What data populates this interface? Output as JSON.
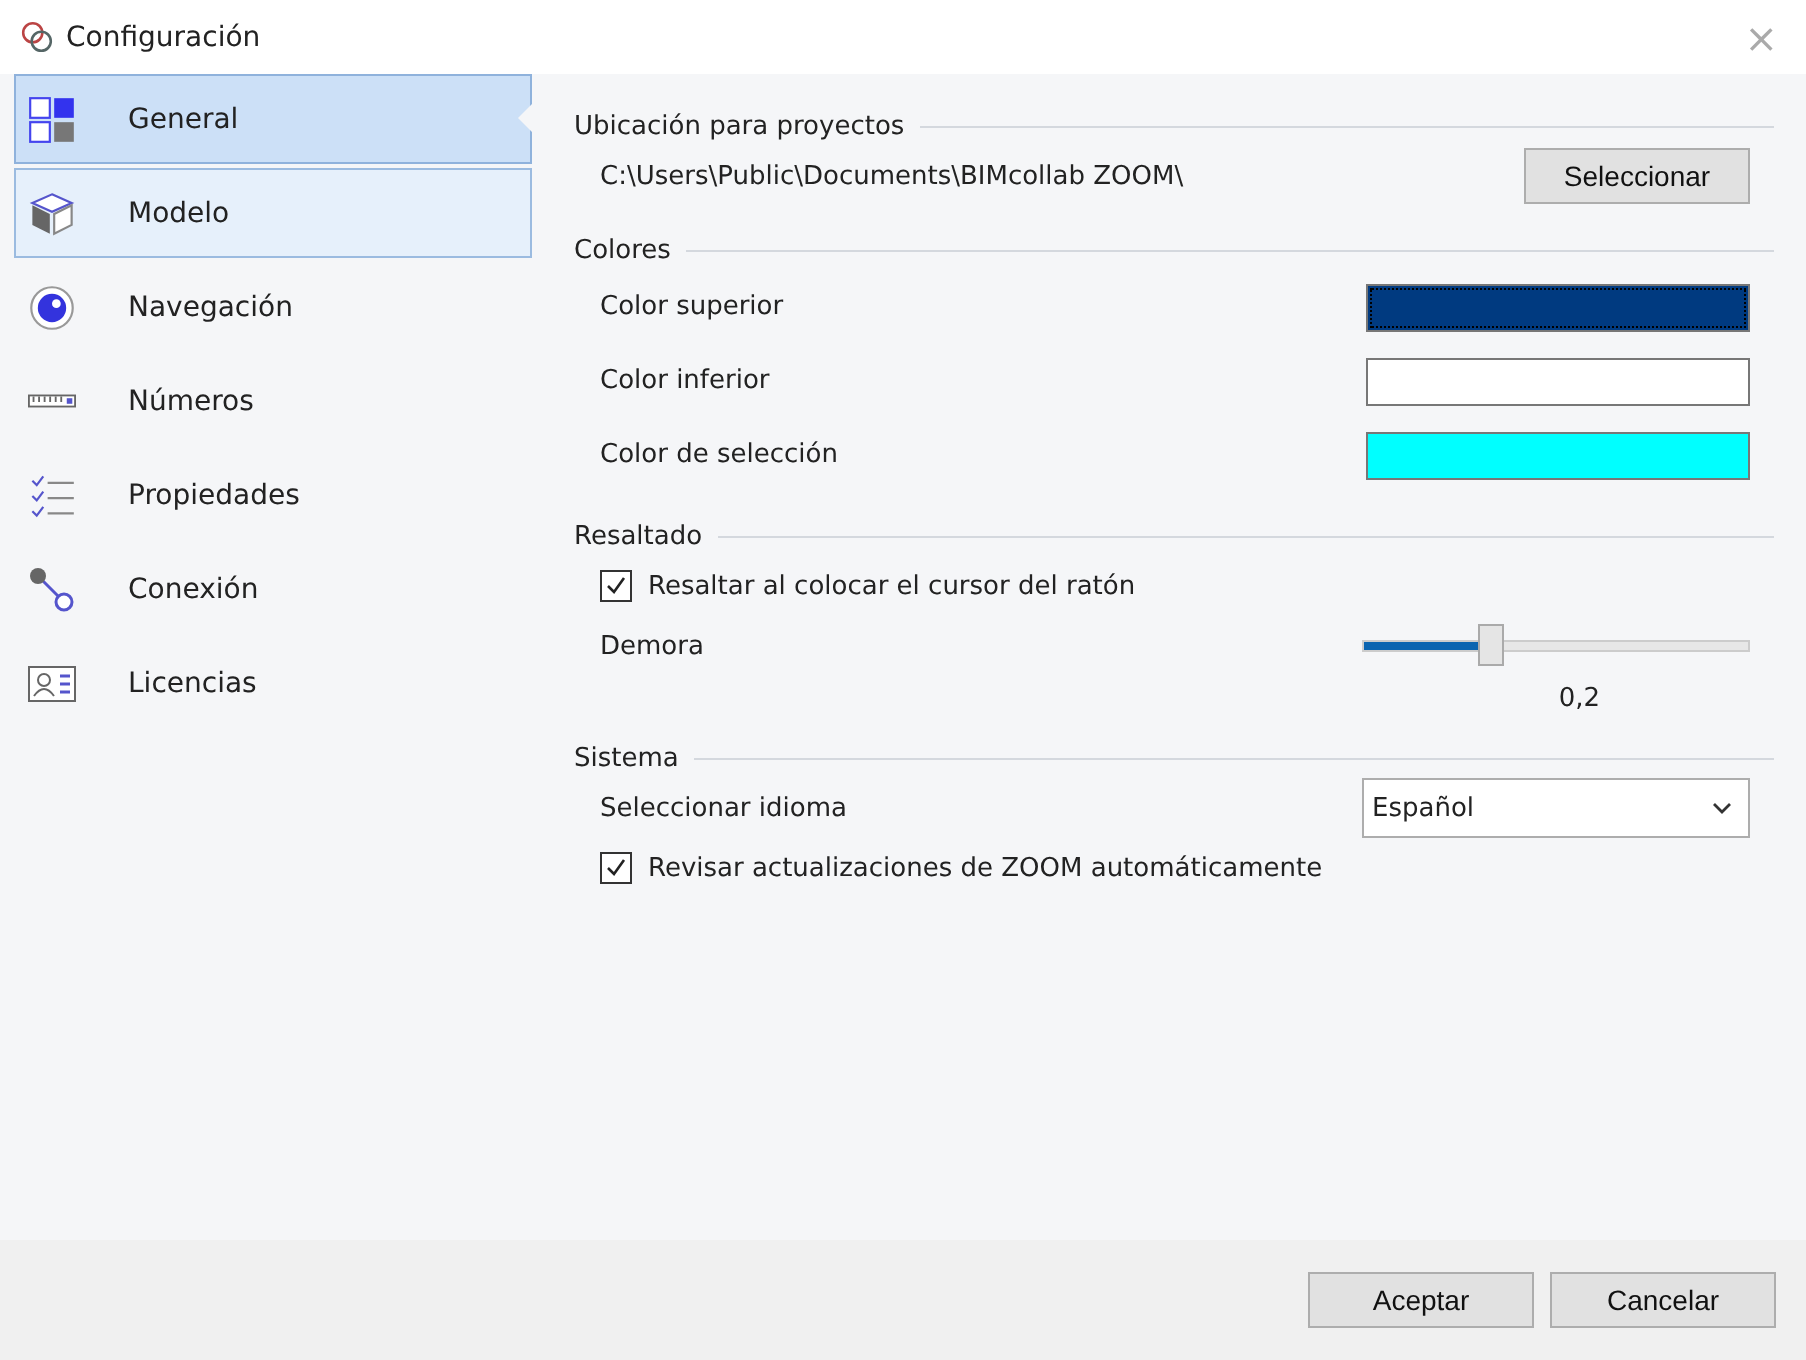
{
  "window": {
    "title": "Configuración",
    "close": "×"
  },
  "sidebar": {
    "items": [
      {
        "label": "General",
        "selected": true,
        "hovered": false
      },
      {
        "label": "Modelo",
        "selected": false,
        "hovered": true
      },
      {
        "label": "Navegación",
        "selected": false,
        "hovered": false
      },
      {
        "label": "Números",
        "selected": false,
        "hovered": false
      },
      {
        "label": "Propiedades",
        "selected": false,
        "hovered": false
      },
      {
        "label": "Conexión",
        "selected": false,
        "hovered": false
      },
      {
        "label": "Licencias",
        "selected": false,
        "hovered": false
      }
    ]
  },
  "sections": [
    {
      "title": "Ubicación para proyectos",
      "rows": [
        {
          "kind": "path",
          "label": "C:\\Users\\Public\\Documents\\BIMcollab ZOOM\\",
          "button": "Seleccionar"
        }
      ]
    },
    {
      "title": "Colores",
      "rows": [
        {
          "kind": "color",
          "label": "Color superior",
          "color": "#003a80",
          "selected": true
        },
        {
          "kind": "color",
          "label": "Color inferior",
          "color": "#ffffff",
          "selected": false
        },
        {
          "kind": "color",
          "label": "Color de selección",
          "color": "#00ffff",
          "selected": false
        }
      ]
    },
    {
      "title": "Resaltado",
      "rows": [
        {
          "kind": "checkbox",
          "label": "Resaltar al colocar el cursor del ratón",
          "checked": true
        },
        {
          "kind": "slider",
          "label": "Demora",
          "level": 0.33,
          "reading": "0,2"
        }
      ]
    },
    {
      "title": "Sistema",
      "rows": [
        {
          "kind": "select",
          "label": "Seleccionar idioma",
          "value": "Español"
        },
        {
          "kind": "checkbox",
          "label": "Revisar actualizaciones de ZOOM automáticamente",
          "checked": true
        }
      ]
    }
  ],
  "buttons": [
    "Aceptar",
    "Cancelar"
  ]
}
